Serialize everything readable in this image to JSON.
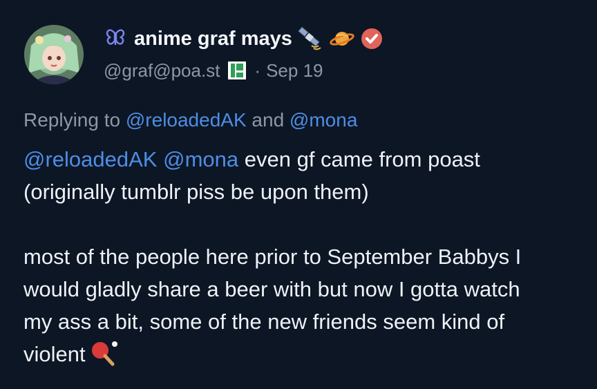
{
  "post": {
    "avatar_icon": "avatar-anime-girl",
    "display_name": "anime graf mays",
    "server_icon": "butterfly-icon",
    "name_emojis": [
      "satellite-icon",
      "ringed-planet-icon"
    ],
    "verified_icon": "check-badge-icon",
    "handle": "@graf@poa.st",
    "instance_icon": "pleroma-icon",
    "separator": "·",
    "timestamp": "Sep 19",
    "reply": {
      "prefix": "Replying to",
      "mention_1": "@reloadedAK",
      "conjunction": "and",
      "mention_2": "@mona"
    },
    "body": {
      "mention_1": "@reloadedAK",
      "mention_2": "@mona",
      "line_1_text": "even gf came from poast",
      "line_2": "(originally tumblr piss be upon them)",
      "paragraph_2_lines": [
        "most of the people here prior to September Babbys I",
        "would gladly share a beer with but now I gotta watch",
        "my ass a bit, some of the new friends seem kind of"
      ],
      "last_word": "violent",
      "trailing_emoji": "ping-pong-icon"
    },
    "colors": {
      "background": "#0d1624",
      "mention": "#4d8ee6",
      "muted": "#8c97a8",
      "text": "#eef2f7",
      "verified": "#e0645a"
    }
  }
}
